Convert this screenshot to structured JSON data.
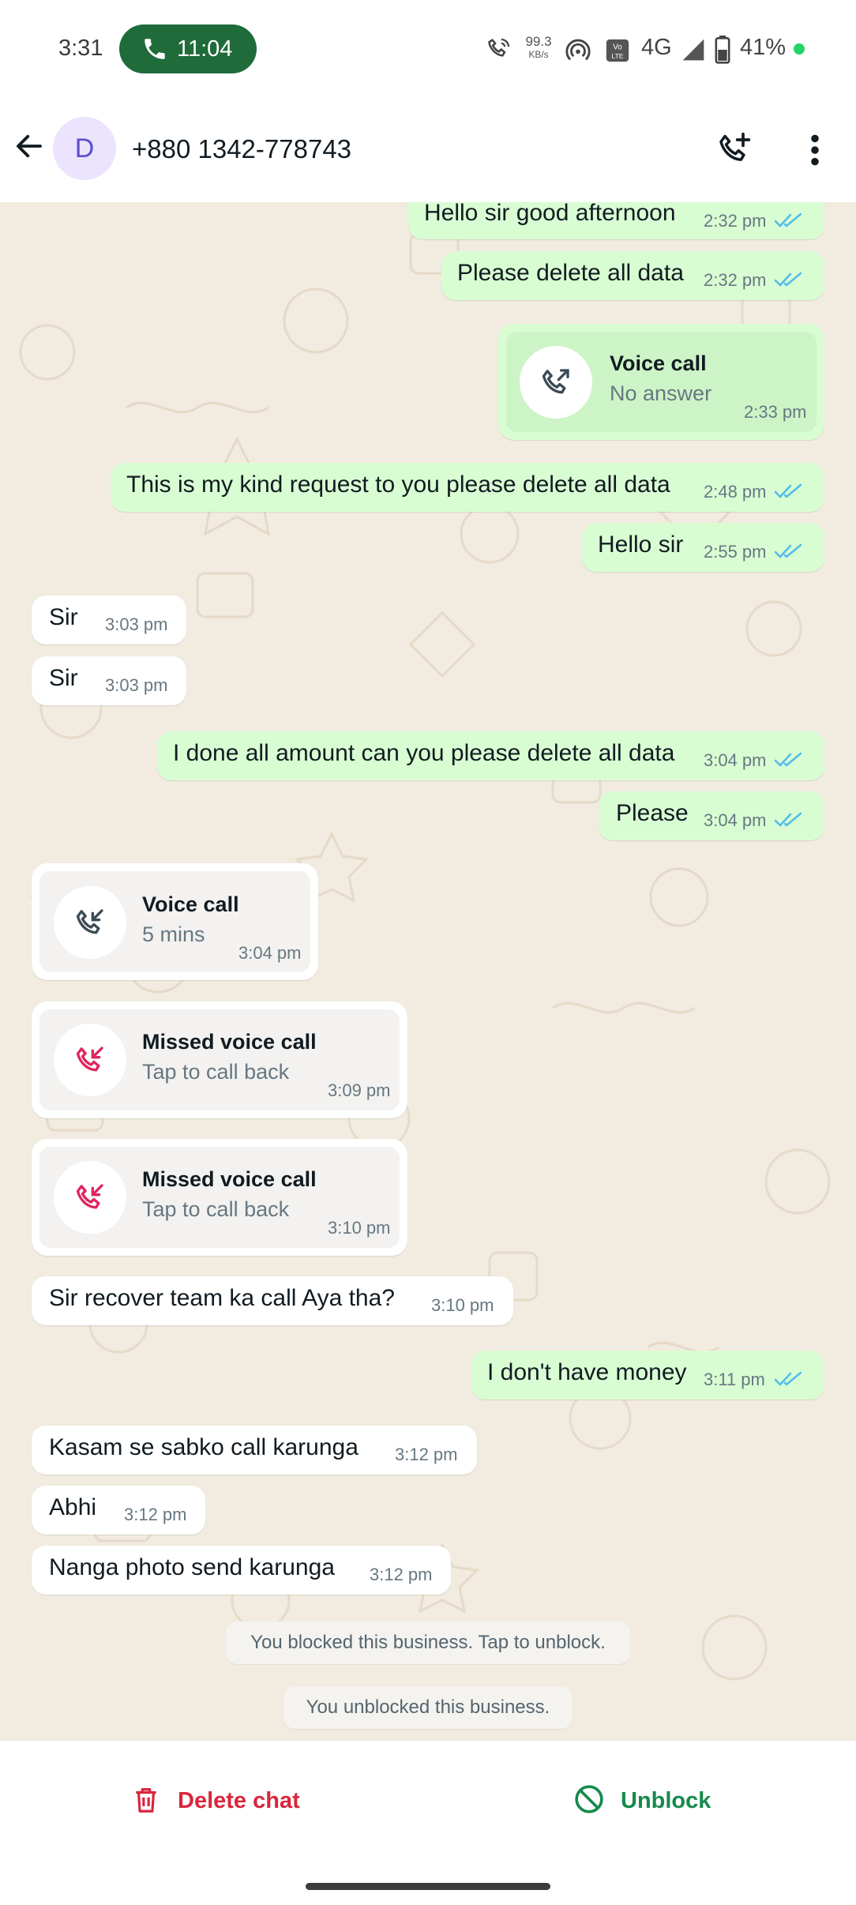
{
  "status_bar": {
    "time": "3:31",
    "call_timer": "11:04",
    "speed_value": "99.3",
    "speed_unit": "KB/s",
    "network": "4G",
    "battery": "41%",
    "indicator_color": "#25d366"
  },
  "header": {
    "avatar_letter": "D",
    "contact": "+880 1342-778743"
  },
  "messages": [
    {
      "dir": "out",
      "text": "Hello sir good afternoon",
      "time": "2:32 pm",
      "read": true
    },
    {
      "dir": "out",
      "text": "Please delete all data",
      "time": "2:32 pm",
      "read": true
    },
    {
      "dir": "out",
      "type": "call",
      "title": "Voice call",
      "subtitle": "No answer",
      "time": "2:33 pm"
    },
    {
      "dir": "out",
      "text": "This is my kind request to you please delete all data",
      "time": "2:48 pm",
      "read": true
    },
    {
      "dir": "out",
      "text": "Hello sir",
      "time": "2:55 pm",
      "read": true
    },
    {
      "dir": "in",
      "text": "Sir",
      "time": "3:03 pm"
    },
    {
      "dir": "in",
      "text": "Sir",
      "time": "3:03 pm"
    },
    {
      "dir": "out",
      "text": "I done all amount can you please delete all data",
      "time": "3:04 pm",
      "read": true
    },
    {
      "dir": "out",
      "text": "Please",
      "time": "3:04 pm",
      "read": true
    },
    {
      "dir": "in",
      "type": "call",
      "title": "Voice call",
      "subtitle": "5 mins",
      "time": "3:04 pm"
    },
    {
      "dir": "in",
      "type": "call",
      "title": "Missed voice call",
      "subtitle": "Tap to call back",
      "time": "3:09 pm",
      "missed": true
    },
    {
      "dir": "in",
      "type": "call",
      "title": "Missed voice call",
      "subtitle": "Tap to call back",
      "time": "3:10 pm",
      "missed": true
    },
    {
      "dir": "in",
      "text": "Sir recover team ka call Aya tha?",
      "time": "3:10 pm"
    },
    {
      "dir": "out",
      "text": "I don't have money",
      "time": "3:11 pm",
      "read": true
    },
    {
      "dir": "in",
      "text": "Kasam se sabko call karunga",
      "time": "3:12 pm"
    },
    {
      "dir": "in",
      "text": "Abhi",
      "time": "3:12 pm"
    },
    {
      "dir": "in",
      "text": "Nanga photo send karunga",
      "time": "3:12 pm"
    }
  ],
  "system_messages": [
    "You blocked this business. Tap to unblock.",
    "You unblocked this business."
  ],
  "actions": {
    "delete_label": "Delete chat",
    "delete_color": "#d9263c",
    "unblock_label": "Unblock",
    "unblock_color": "#168a4d"
  },
  "colors": {
    "outgoing_bubble": "#d9fdd3",
    "incoming_bubble": "#ffffff",
    "chat_background": "#f1ebe0",
    "read_tick": "#53bdeb"
  }
}
